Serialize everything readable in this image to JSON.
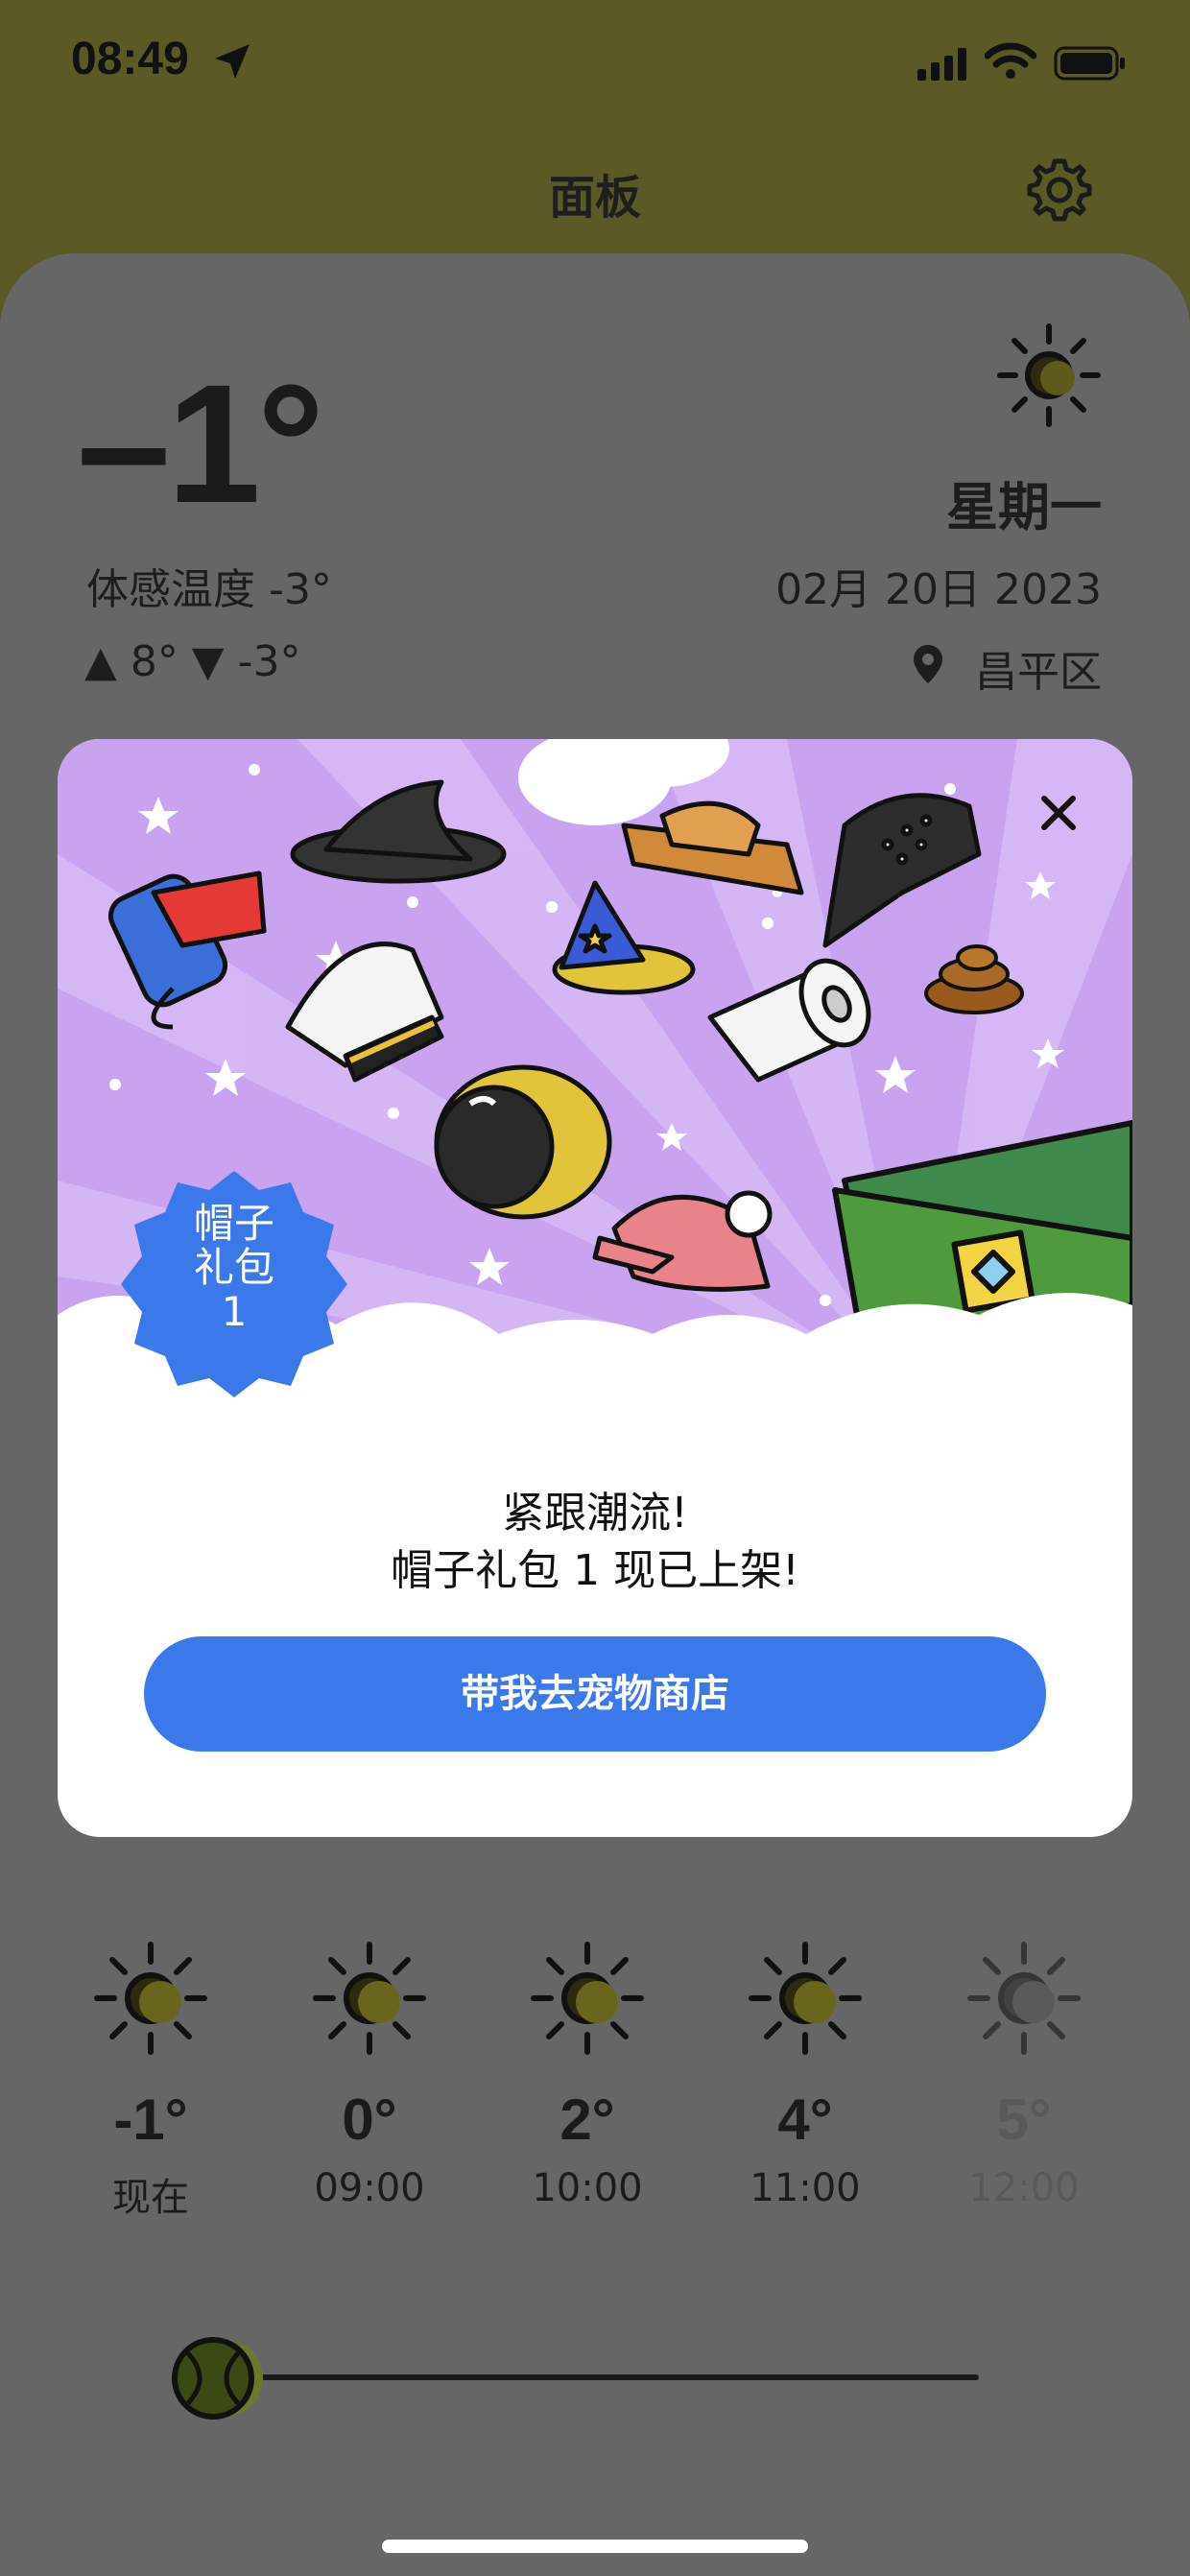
{
  "status_bar": {
    "time": "08:49"
  },
  "header": {
    "title": "面板"
  },
  "current": {
    "temp": "–1°",
    "feels_like": "体感温度 -3°",
    "high_low": "▲ 8° ▼ -3°",
    "weekday": "星期一",
    "date": "02月 20日 2023",
    "location": "昌平区"
  },
  "promo": {
    "badge": "帽子礼包 1",
    "line1": "紧跟潮流!",
    "line2": "帽子礼包 1 现已上架!",
    "cta": "带我去宠物商店"
  },
  "hourly": [
    {
      "temp": "-1°",
      "time": "现在"
    },
    {
      "temp": "0°",
      "time": "09:00"
    },
    {
      "temp": "2°",
      "time": "10:00"
    },
    {
      "temp": "4°",
      "time": "11:00"
    },
    {
      "temp": "5°",
      "time": "12:00"
    }
  ],
  "colors": {
    "accent": "#3b78ea",
    "header_bg": "#5b5925",
    "promo_bg": "#c9a2f0"
  }
}
